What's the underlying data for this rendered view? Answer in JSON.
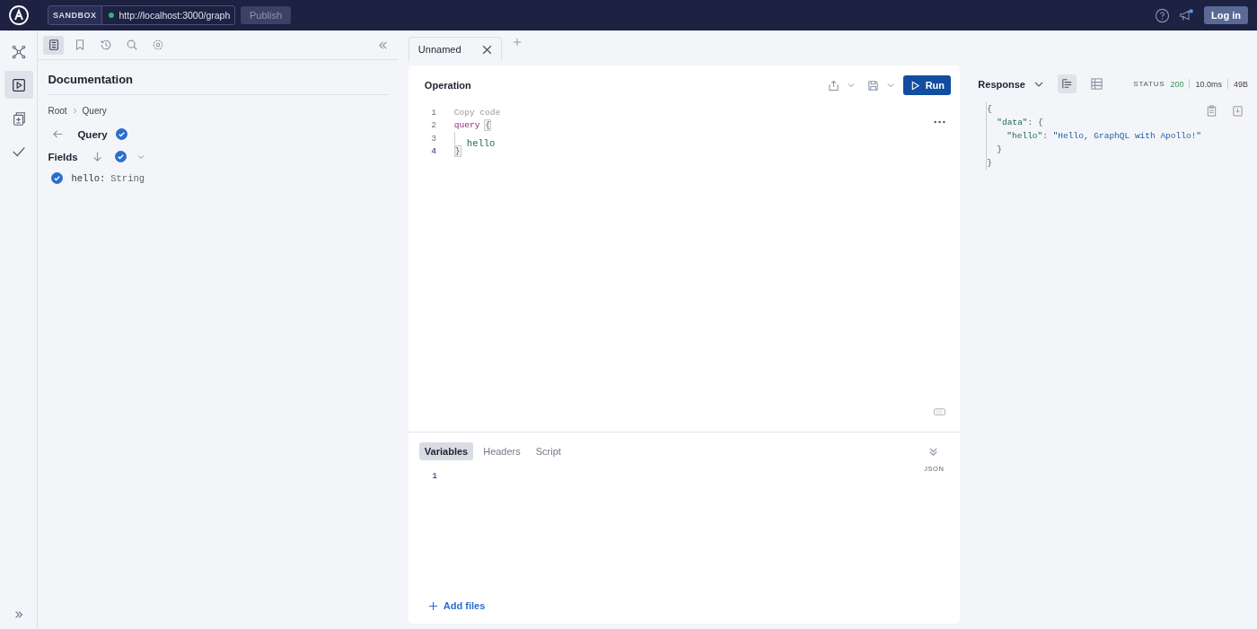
{
  "topbar": {
    "sandbox_label": "SANDBOX",
    "url": "http://localhost:3000/graph",
    "connected": true,
    "publish": {
      "label": "Publish",
      "disabled": true
    },
    "notification": true,
    "login": "Log in"
  },
  "rail": [
    {
      "kind": "graph",
      "selected": false
    },
    {
      "kind": "play",
      "selected": true
    },
    {
      "kind": "diff",
      "selected": false
    },
    {
      "kind": "check",
      "selected": false
    }
  ],
  "docs": {
    "toolbar": [
      {
        "kind": "doc",
        "selected": true
      },
      {
        "kind": "bookmark",
        "selected": false
      },
      {
        "kind": "history",
        "selected": false
      },
      {
        "kind": "search",
        "selected": false
      },
      {
        "kind": "gear",
        "selected": false
      }
    ],
    "title": "Documentation",
    "breadcrumb": [
      "Root",
      "Query"
    ],
    "heading": "Query",
    "heading_checked": true,
    "fields_label": "Fields",
    "fields_checked": true,
    "fields": [
      {
        "name": "hello:",
        "type": "String",
        "checked": true
      }
    ]
  },
  "tabs": [
    {
      "label": "Unnamed",
      "selected": true
    }
  ],
  "operation": {
    "title": "Operation",
    "run": "Run",
    "lines": [
      {
        "number": "1",
        "active": false,
        "tokens": [
          {
            "kind": "comment",
            "text": "Copy code"
          }
        ]
      },
      {
        "number": "2",
        "active": false,
        "tokens": [
          {
            "kind": "keyword",
            "text": "query"
          },
          {
            "kind": "brace",
            "text": "{"
          }
        ]
      },
      {
        "number": "3",
        "active": false,
        "tokens": [
          {
            "kind": "indent"
          },
          {
            "kind": "field",
            "text": "hello"
          }
        ]
      },
      {
        "number": "4",
        "active": true,
        "tokens": [
          {
            "kind": "brace",
            "text": "}"
          }
        ]
      }
    ]
  },
  "variables": {
    "tabs": [
      {
        "label": "Variables",
        "selected": true
      },
      {
        "label": "Headers",
        "selected": false
      },
      {
        "label": "Script",
        "selected": false
      }
    ],
    "line": "1",
    "format": "JSON",
    "add_files": "Add files"
  },
  "response": {
    "title": "Response",
    "views": [
      {
        "kind": "text",
        "selected": true
      },
      {
        "kind": "table",
        "selected": false
      }
    ],
    "status_label": "STATUS",
    "status": "200",
    "time": "10.0ms",
    "size": "49B",
    "json": {
      "open": "{",
      "close": "}",
      "children": [
        {
          "key": "\"data\"",
          "open": ": {",
          "close": "}",
          "children": [
            {
              "key": "\"hello\"",
              "sep": ": ",
              "value": "\"Hello, GraphQL with Apollo!\""
            }
          ]
        }
      ]
    }
  }
}
